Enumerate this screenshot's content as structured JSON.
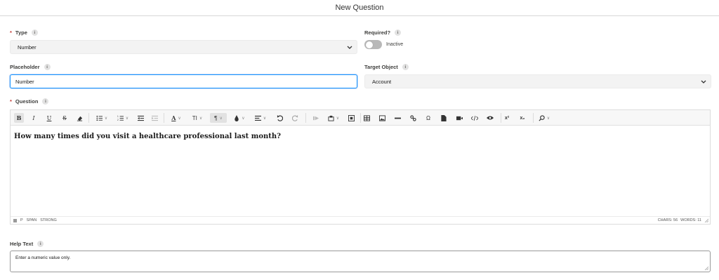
{
  "header": {
    "title": "New Question"
  },
  "type_field": {
    "label": "Type",
    "value": "Number"
  },
  "required_field": {
    "label": "Required?",
    "toggle_state": "Inactive"
  },
  "placeholder_field": {
    "label": "Placeholder",
    "value": "Number"
  },
  "target_object_field": {
    "label": "Target Object",
    "value": "Account"
  },
  "question_field": {
    "label": "Question",
    "content": "How many times did you visit a healthcare professional last month?",
    "statusbar": {
      "path": [
        "P",
        "SPAN",
        "STRONG"
      ],
      "chars": "CHARS: 56",
      "words": "WORDS: 11"
    },
    "toolbar": {
      "bold": "B",
      "italic": "I",
      "underline": "U",
      "strike": "S",
      "font_color": "A",
      "font_size": "TI",
      "paragraph": "¶",
      "special_char": "Ω",
      "superscript": "x²",
      "subscript": "x₂"
    }
  },
  "help_text_field": {
    "label": "Help Text",
    "value": "Enter a numeric value only."
  },
  "info_glyph": "i",
  "icons": [
    "info-icon",
    "chevron-down-icon",
    "bold-icon",
    "italic-icon",
    "underline-icon",
    "strikethrough-icon",
    "eraser-icon",
    "bullet-list-icon",
    "numbered-list-icon",
    "indent-icon",
    "outdent-icon",
    "font-color-icon",
    "font-size-icon",
    "paragraph-icon",
    "brush-icon",
    "align-icon",
    "undo-icon",
    "redo-icon",
    "video-icon",
    "copy-format-icon",
    "select-all-icon",
    "table-icon",
    "image-icon",
    "horizontal-line-icon",
    "link-icon",
    "special-char-icon",
    "file-icon",
    "video-camera-icon",
    "source-code-icon",
    "preview-icon",
    "superscript-icon",
    "subscript-icon",
    "search-icon",
    "resize-grip-icon"
  ],
  "colors": {
    "required_star": "#c23934",
    "focus_border": "#1b96ff",
    "toggle_off": "#b8b8b8"
  }
}
